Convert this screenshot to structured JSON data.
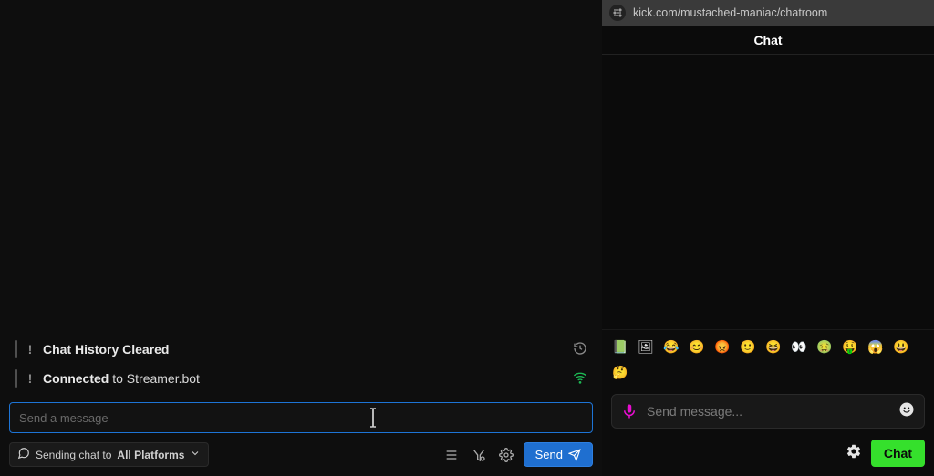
{
  "left": {
    "messages": [
      {
        "bold": "Chat History Cleared",
        "rest": "",
        "tail_icon": "history"
      },
      {
        "bold": "Connected",
        "rest": " to Streamer.bot",
        "tail_icon": "wifi"
      }
    ],
    "input_placeholder": "Send a message",
    "platform_prefix": "Sending chat to ",
    "platform_value": "All Platforms",
    "send_label": "Send"
  },
  "right": {
    "url": "kick.com/mustached-maniac/chatroom",
    "chat_header": "Chat",
    "input_placeholder": "Send message...",
    "chat_button": "Chat",
    "emotes": [
      "📗",
      "🖼",
      "😂",
      "😊",
      "😡",
      "🙂",
      "😆",
      "👀",
      "🤢",
      "🤑",
      "😱",
      "😃",
      "🤔"
    ]
  }
}
